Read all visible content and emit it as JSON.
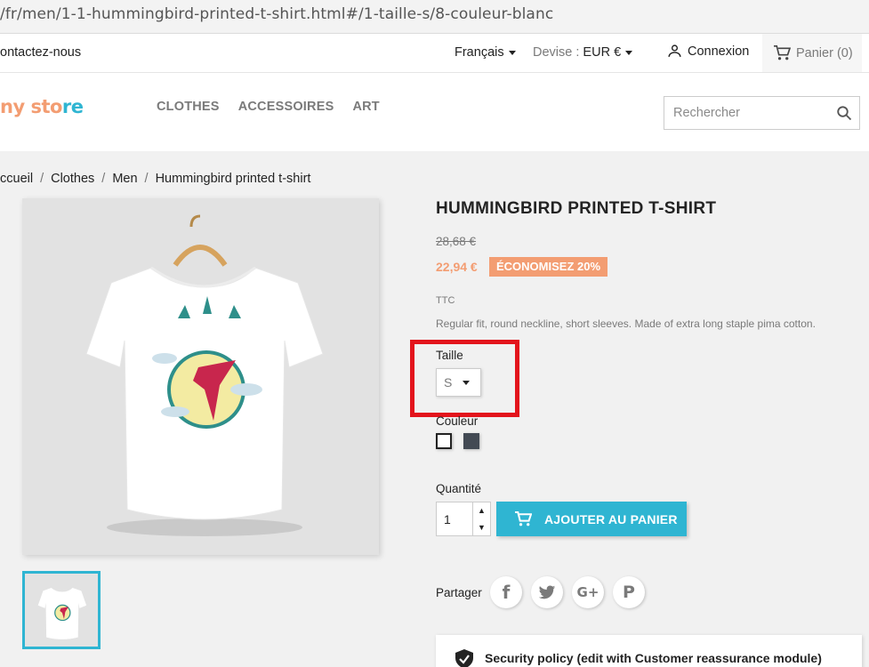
{
  "browser": {
    "url": "/fr/men/1-1-hummingbird-printed-t-shirt.html#/1-taille-s/8-couleur-blanc"
  },
  "topnav": {
    "contact": "ontactez-nous",
    "language": "Français",
    "currency_label": "Devise :",
    "currency_value": "EUR €",
    "login": "Connexion",
    "cart": "Panier (0)"
  },
  "header": {
    "logo_parts": [
      "ny ",
      "sto",
      "re"
    ],
    "menu": [
      "CLOTHES",
      "ACCESSOIRES",
      "ART"
    ],
    "search_placeholder": "Rechercher"
  },
  "breadcrumb": [
    "ccueil",
    "Clothes",
    "Men",
    "Hummingbird printed t-shirt"
  ],
  "product": {
    "title": "HUMMINGBIRD PRINTED T-SHIRT",
    "regular_price": "28,68 €",
    "price": "22,94 €",
    "discount": "ÉCONOMISEZ 20%",
    "tax_label": "TTC",
    "description": "Regular fit, round neckline, short sleeves. Made of extra long staple pima cotton.",
    "size_label": "Taille",
    "size_value": "S",
    "color_label": "Couleur",
    "colors": [
      "#ffffff",
      "#434a54"
    ],
    "quantity_label": "Quantité",
    "quantity_value": "1",
    "add_to_cart": "AJOUTER AU PANIER",
    "share_label": "Partager",
    "social_icons": [
      "f",
      "twitter-bird",
      "G+",
      "P"
    ]
  },
  "reassurance": {
    "security": "Security policy (edit with Customer reassurance module)"
  },
  "colors": {
    "accent": "#2fb5d2",
    "sale": "#f39d72",
    "highlight": "#e3141c"
  }
}
